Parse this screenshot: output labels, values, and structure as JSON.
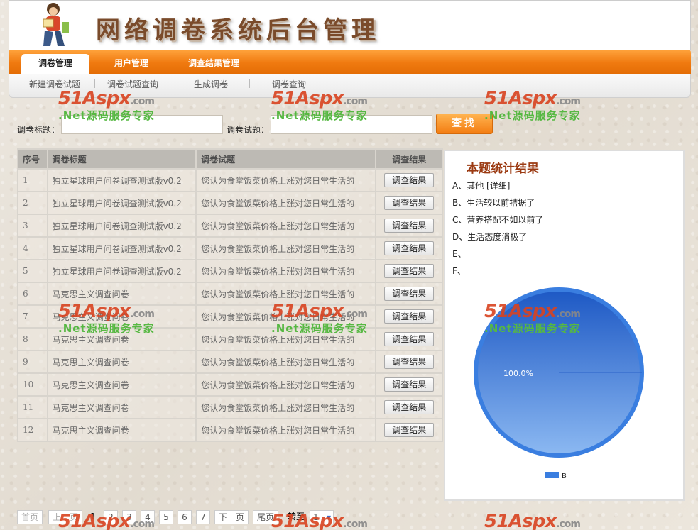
{
  "header": {
    "title": "网络调卷系统后台管理"
  },
  "nav": {
    "tabs": [
      {
        "label": "调卷管理",
        "active": true
      },
      {
        "label": "用户管理"
      },
      {
        "label": "调查结果管理"
      }
    ]
  },
  "subnav": {
    "items": [
      "新建调卷试题",
      "调卷试题查询",
      "生成调卷",
      "调卷查询"
    ]
  },
  "search": {
    "title_label": "调卷标题：",
    "question_label": "调卷试题：",
    "button_label": "查找"
  },
  "table": {
    "headers": [
      "序号",
      "调卷标题",
      "调卷试题",
      "调查结果"
    ],
    "rows": [
      {
        "no": "1",
        "title": "独立星球用户问卷调查测试版v0.2",
        "question": "您认为食堂饭菜价格上涨对您日常生活的",
        "action": "调查结果"
      },
      {
        "no": "2",
        "title": "独立星球用户问卷调查测试版v0.2",
        "question": "您认为食堂饭菜价格上涨对您日常生活的",
        "action": "调查结果"
      },
      {
        "no": "3",
        "title": "独立星球用户问卷调查测试版v0.2",
        "question": "您认为食堂饭菜价格上涨对您日常生活的",
        "action": "调查结果"
      },
      {
        "no": "4",
        "title": "独立星球用户问卷调查测试版v0.2",
        "question": "您认为食堂饭菜价格上涨对您日常生活的",
        "action": "调查结果"
      },
      {
        "no": "5",
        "title": "独立星球用户问卷调查测试版v0.2",
        "question": "您认为食堂饭菜价格上涨对您日常生活的",
        "action": "调查结果"
      },
      {
        "no": "6",
        "title": "马克思主义调查问卷",
        "question": "您认为食堂饭菜价格上涨对您日常生活的",
        "action": "调查结果"
      },
      {
        "no": "7",
        "title": "马克思主义调查问卷",
        "question": "您认为食堂饭菜价格上涨对您日常生活的",
        "action": "调查结果"
      },
      {
        "no": "8",
        "title": "马克思主义调查问卷",
        "question": "您认为食堂饭菜价格上涨对您日常生活的",
        "action": "调查结果"
      },
      {
        "no": "9",
        "title": "马克思主义调查问卷",
        "question": "您认为食堂饭菜价格上涨对您日常生活的",
        "action": "调查结果"
      },
      {
        "no": "10",
        "title": "马克思主义调查问卷",
        "question": "您认为食堂饭菜价格上涨对您日常生活的",
        "action": "调查结果"
      },
      {
        "no": "11",
        "title": "马克思主义调查问卷",
        "question": "您认为食堂饭菜价格上涨对您日常生活的",
        "action": "调查结果"
      },
      {
        "no": "12",
        "title": "马克思主义调查问卷",
        "question": "您认为食堂饭菜价格上涨对您日常生活的",
        "action": "调查结果"
      }
    ]
  },
  "stats": {
    "title": "本题统计结果",
    "options": [
      "A、其他 [详细]",
      "B、生活较以前拮据了",
      "C、营养搭配不如以前了",
      "D、生活态度消极了",
      "E、",
      "F、"
    ]
  },
  "chart_data": {
    "type": "pie",
    "categories": [
      "B"
    ],
    "values": [
      100.0
    ],
    "labels": [
      "100.0%"
    ],
    "legend": "bottom",
    "colors": [
      "#3a7ee0"
    ]
  },
  "pagination": {
    "first": "首页",
    "prev": "上一页",
    "pages": [
      "1",
      "2",
      "3",
      "4",
      "5",
      "6",
      "7"
    ],
    "current": "1",
    "next": "下一页",
    "last": "尾页",
    "goto_label": "转至",
    "goto_value": "1"
  },
  "watermark": {
    "brand": "51Aspx",
    "domain": ".com",
    "tagline": ".Net源码服务专家"
  },
  "colors": {
    "nav_orange": "#f07a10",
    "title_brown": "#9b3a12",
    "pie_blue": "#3a7ee0"
  }
}
